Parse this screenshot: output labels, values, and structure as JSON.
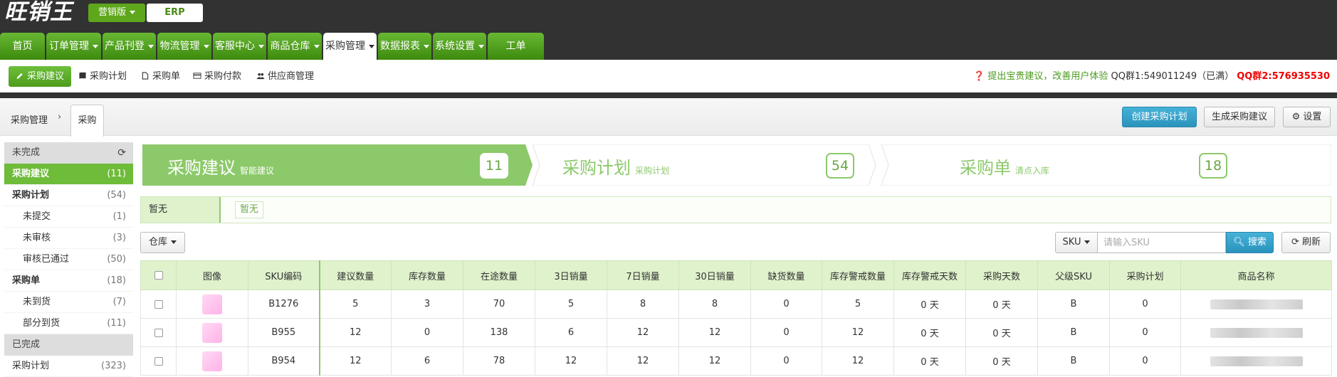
{
  "app": {
    "logo": "旺销王",
    "edition_label": "营销版",
    "erp_label": "ERP"
  },
  "main_nav": [
    {
      "label": "首页",
      "dropdown": false,
      "active": false
    },
    {
      "label": "订单管理",
      "dropdown": true,
      "active": false
    },
    {
      "label": "产品刊登",
      "dropdown": true,
      "active": false
    },
    {
      "label": "物流管理",
      "dropdown": true,
      "active": false
    },
    {
      "label": "客服中心",
      "dropdown": true,
      "active": false
    },
    {
      "label": "商品仓库",
      "dropdown": true,
      "active": false
    },
    {
      "label": "采购管理",
      "dropdown": true,
      "active": true
    },
    {
      "label": "数据报表",
      "dropdown": true,
      "active": false
    },
    {
      "label": "系统设置",
      "dropdown": true,
      "active": false
    },
    {
      "label": "工单",
      "dropdown": false,
      "active": false
    }
  ],
  "sub_nav": [
    {
      "label": "采购建议",
      "icon": "pencil-icon",
      "active": true
    },
    {
      "label": "采购计划",
      "icon": "book-icon",
      "active": false
    },
    {
      "label": "采购单",
      "icon": "file-icon",
      "active": false
    },
    {
      "label": "采购付款",
      "icon": "credit-card-icon",
      "active": false
    },
    {
      "label": "供应商管理",
      "icon": "users-icon",
      "active": false
    }
  ],
  "tips": {
    "feedback": "提出宝贵建议，改善用户体验",
    "qq1": "QQ群1:549011249（已满）",
    "qq2": "QQ群2:576935530"
  },
  "breadcrumb": {
    "parent": "采购管理",
    "current": "采购"
  },
  "actions": {
    "create_plan": "创建采购计划",
    "generate": "生成采购建议",
    "settings": "设置"
  },
  "sidebar": {
    "pending_group": "未完成",
    "done_group": "已完成",
    "items": [
      {
        "label": "采购建议",
        "count": "(11)",
        "level": 1,
        "active": true
      },
      {
        "label": "采购计划",
        "count": "(54)",
        "level": 1,
        "active": false
      },
      {
        "label": "未提交",
        "count": "(1)",
        "level": 2,
        "active": false
      },
      {
        "label": "未审核",
        "count": "(3)",
        "level": 2,
        "active": false
      },
      {
        "label": "审核已通过",
        "count": "(50)",
        "level": 2,
        "active": false
      },
      {
        "label": "采购单",
        "count": "(18)",
        "level": 1,
        "active": false
      },
      {
        "label": "未到货",
        "count": "(7)",
        "level": 2,
        "active": false
      },
      {
        "label": "部分到货",
        "count": "(11)",
        "level": 2,
        "active": false
      }
    ],
    "done_items": [
      {
        "label": "采购计划",
        "count": "(323)"
      }
    ]
  },
  "steps": [
    {
      "title": "采购建议",
      "subtitle": "智能建议",
      "count": "11"
    },
    {
      "title": "采购计划",
      "subtitle": "采购计划",
      "count": "54"
    },
    {
      "title": "采购单",
      "subtitle": "清点入库",
      "count": "18"
    }
  ],
  "filter": {
    "label": "暂无",
    "tag": "暂无"
  },
  "toolbar": {
    "warehouse": "仓库",
    "sku_select": "SKU",
    "sku_placeholder": "请输入SKU",
    "search": "搜索",
    "refresh": "刷新"
  },
  "table": {
    "columns": [
      "",
      "图像",
      "SKU编码",
      "建议数量",
      "库存数量",
      "在途数量",
      "3日销量",
      "7日销量",
      "30日销量",
      "缺货数量",
      "库存警戒数量",
      "库存警戒天数",
      "采购天数",
      "父级SKU",
      "采购计划",
      "商品名称"
    ],
    "rows": [
      {
        "sku": "B1276",
        "suggest": "5",
        "stock": "3",
        "transit": "70",
        "sales3": "5",
        "sales7": "8",
        "sales30": "8",
        "shortage": "0",
        "warn_qty": "5",
        "warn_days": "0 天",
        "purchase_days": "0 天",
        "parent_sku": "B",
        "plan": "0"
      },
      {
        "sku": "B955",
        "suggest": "12",
        "stock": "0",
        "transit": "138",
        "sales3": "6",
        "sales7": "12",
        "sales30": "12",
        "shortage": "0",
        "warn_qty": "12",
        "warn_days": "0 天",
        "purchase_days": "0 天",
        "parent_sku": "B",
        "plan": "0"
      },
      {
        "sku": "B954",
        "suggest": "12",
        "stock": "6",
        "transit": "78",
        "sales3": "12",
        "sales7": "12",
        "sales30": "12",
        "shortage": "0",
        "warn_qty": "12",
        "warn_days": "0 天",
        "purchase_days": "0 天",
        "parent_sku": "B",
        "plan": "0"
      }
    ]
  },
  "colors": {
    "nav_green": "#5ea71c",
    "accent_green": "#6fbb3a",
    "light_green": "#dff2cc",
    "blue_button": "#2b93bd",
    "dark_bar": "#323232",
    "qq_red": "#e00000"
  }
}
